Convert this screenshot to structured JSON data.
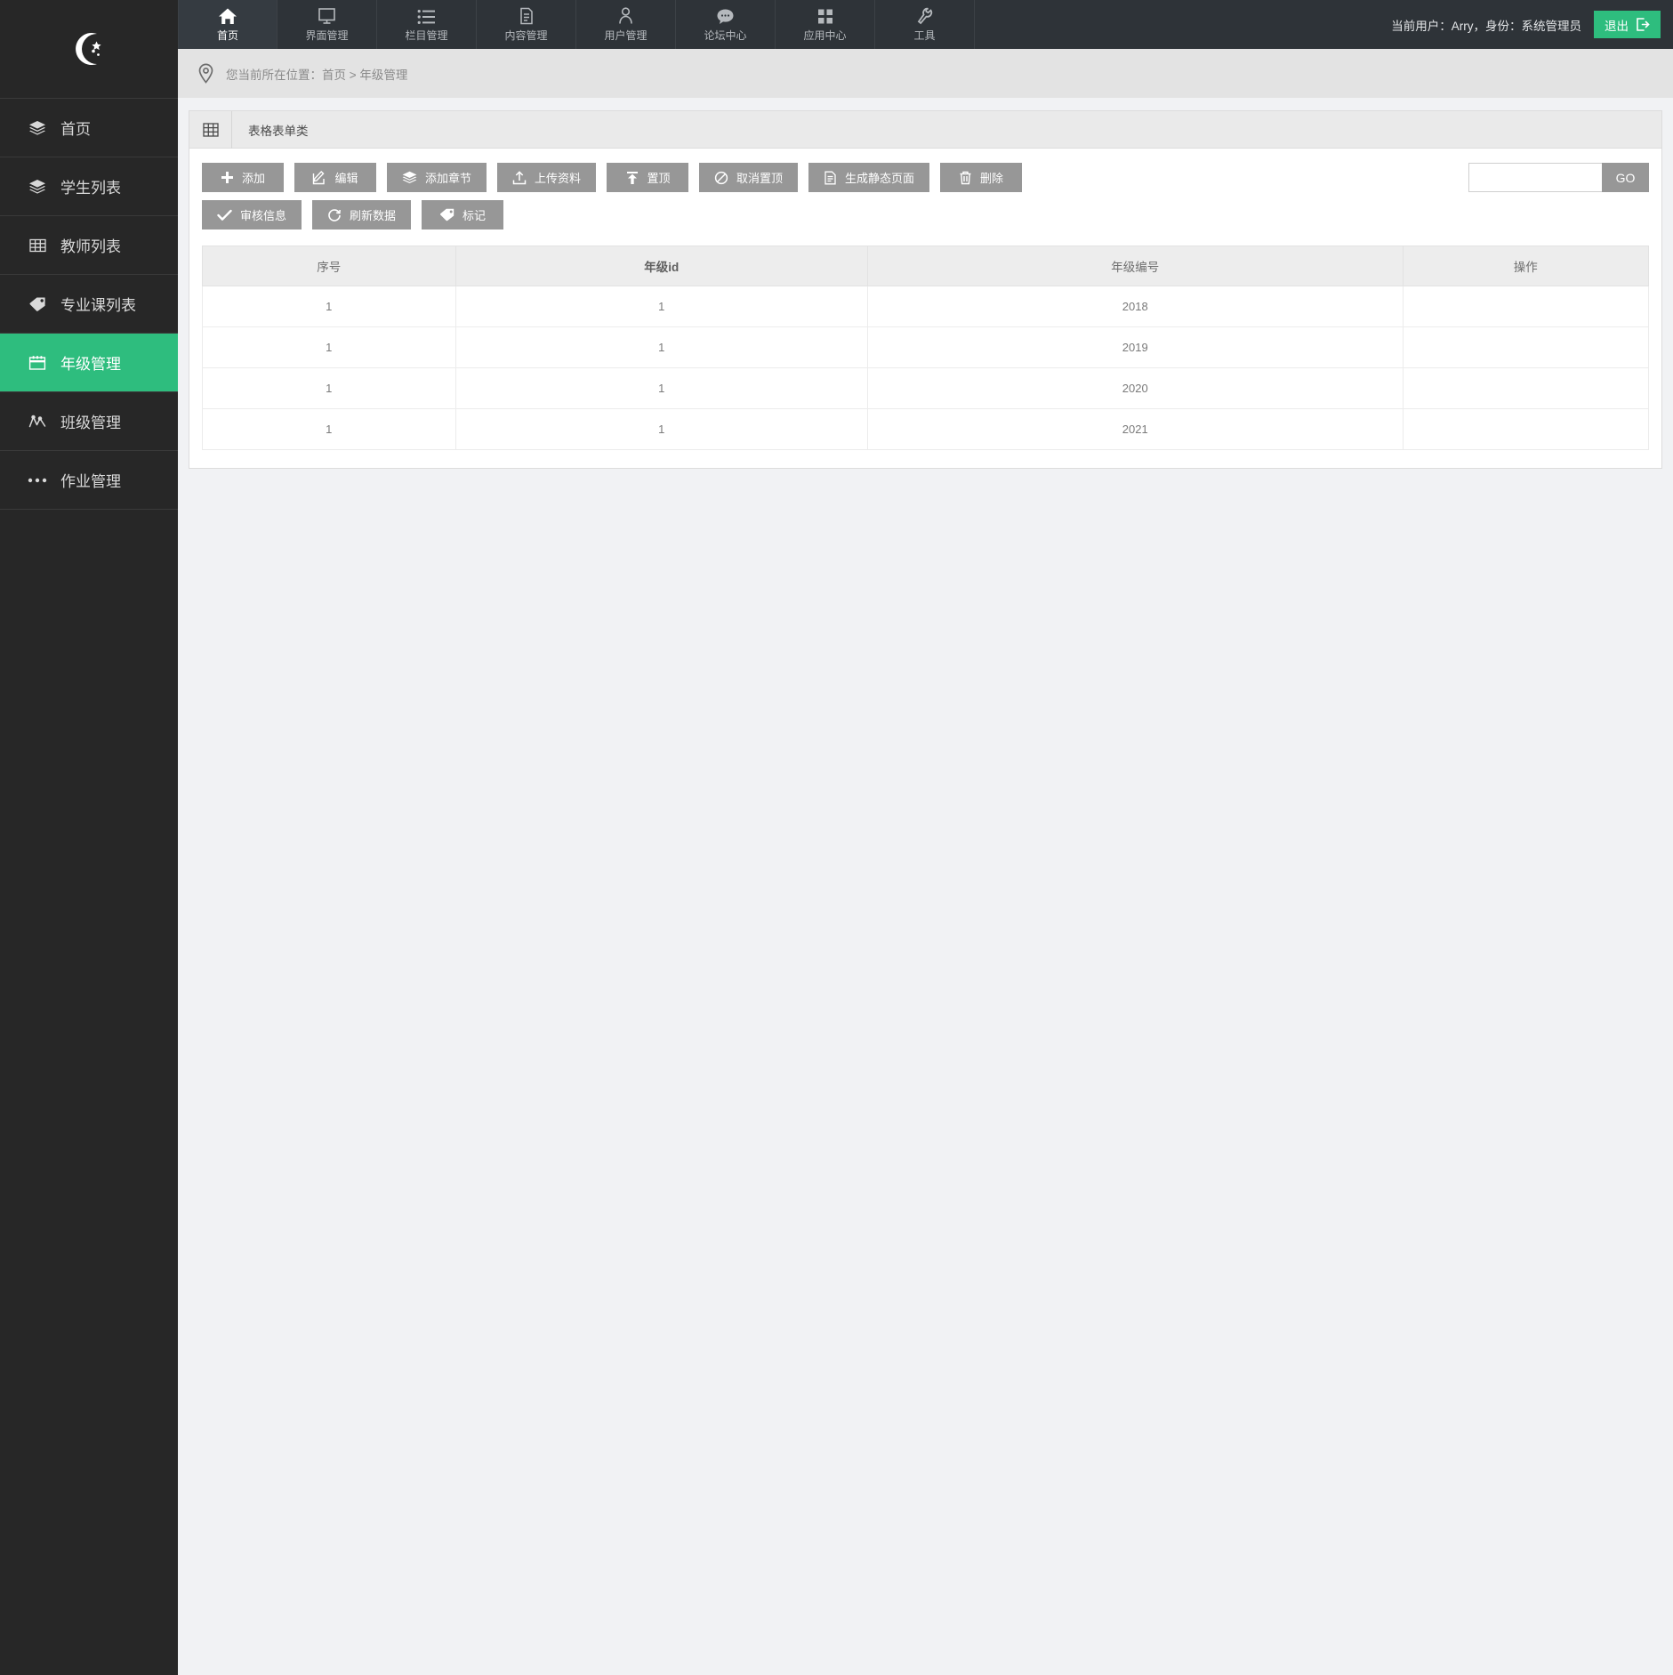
{
  "colors": {
    "accent": "#2ebd7e",
    "sidebar_bg": "#272727",
    "topbar_bg": "#2e3338",
    "button_gray": "#979797",
    "page_bg": "#f1f2f4"
  },
  "sidebar": {
    "logo_icon": "crescent-moon-stars-icon",
    "items": [
      {
        "label": "首页",
        "icon": "layers-icon",
        "active": false
      },
      {
        "label": "学生列表",
        "icon": "layers-icon",
        "active": false
      },
      {
        "label": "教师列表",
        "icon": "grid-table-icon",
        "active": false
      },
      {
        "label": "专业课列表",
        "icon": "tag-icon",
        "active": false
      },
      {
        "label": "年级管理",
        "icon": "calendar-icon",
        "active": true
      },
      {
        "label": "班级管理",
        "icon": "chart-line-icon",
        "active": false
      },
      {
        "label": "作业管理",
        "icon": "dots-icon",
        "active": false
      }
    ]
  },
  "topbar": {
    "tabs": [
      {
        "label": "首页",
        "icon": "home-icon",
        "active": true
      },
      {
        "label": "界面管理",
        "icon": "monitor-icon",
        "active": false
      },
      {
        "label": "栏目管理",
        "icon": "list-icon",
        "active": false
      },
      {
        "label": "内容管理",
        "icon": "document-icon",
        "active": false
      },
      {
        "label": "用户管理",
        "icon": "user-icon",
        "active": false
      },
      {
        "label": "论坛中心",
        "icon": "comment-icon",
        "active": false
      },
      {
        "label": "应用中心",
        "icon": "apps-icon",
        "active": false
      },
      {
        "label": "工具",
        "icon": "wrench-icon",
        "active": false
      }
    ],
    "current_user_text": "当前用户：Arry，身份：系统管理员",
    "logout_label": "退出",
    "logout_icon": "sign-out-icon"
  },
  "breadcrumb": {
    "icon": "map-pin-icon",
    "text": "您当前所在位置：首页 > 年级管理"
  },
  "panel": {
    "icon": "table-icon",
    "title": "表格表单类"
  },
  "toolbar": {
    "row1": [
      {
        "label": "添加",
        "icon": "plus-icon"
      },
      {
        "label": "编辑",
        "icon": "edit-pencil-icon"
      },
      {
        "label": "添加章节",
        "icon": "layers-icon"
      },
      {
        "label": "上传资料",
        "icon": "upload-icon"
      },
      {
        "label": "置顶",
        "icon": "arrow-up-top-icon"
      },
      {
        "label": "取消置顶",
        "icon": "ban-icon"
      },
      {
        "label": "生成静态页面",
        "icon": "page-icon"
      },
      {
        "label": "删除",
        "icon": "trash-icon"
      }
    ],
    "row2": [
      {
        "label": "审核信息",
        "icon": "check-icon"
      },
      {
        "label": "刷新数据",
        "icon": "refresh-icon"
      },
      {
        "label": "标记",
        "icon": "tag-icon"
      }
    ],
    "search": {
      "value": "",
      "placeholder": "",
      "go_label": "GO"
    }
  },
  "table": {
    "headers": [
      "序号",
      "年级id",
      "年级编号",
      "操作"
    ],
    "rows": [
      {
        "seq": "1",
        "grade_id": "1",
        "grade_no": "2018",
        "op": ""
      },
      {
        "seq": "1",
        "grade_id": "1",
        "grade_no": "2019",
        "op": ""
      },
      {
        "seq": "1",
        "grade_id": "1",
        "grade_no": "2020",
        "op": ""
      },
      {
        "seq": "1",
        "grade_id": "1",
        "grade_no": "2021",
        "op": ""
      }
    ]
  }
}
